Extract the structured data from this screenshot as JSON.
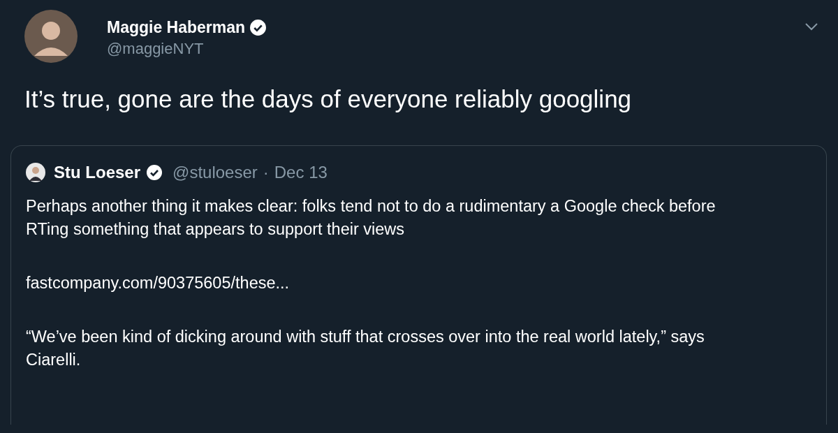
{
  "tweet": {
    "author": {
      "name": "Maggie Haberman",
      "verified": true,
      "handle": "@maggieNYT"
    },
    "text": "It’s true, gone are the days of everyone reliably googling",
    "quoted": {
      "author": {
        "name": "Stu Loeser",
        "verified": true,
        "handle": "@stuloeser"
      },
      "separator": "·",
      "date": "Dec 13",
      "paragraphs": [
        {
          "kind": "text",
          "text": "Perhaps another thing it makes clear: folks tend not to do a rudimentary a Google check before RTing something that appears to support their views"
        },
        {
          "kind": "link",
          "text": "fastcompany.com/90375605/these..."
        },
        {
          "kind": "text",
          "text": "“We’ve been kind of dicking around with stuff that crosses over into the real world lately,” says Ciarelli."
        }
      ]
    }
  }
}
